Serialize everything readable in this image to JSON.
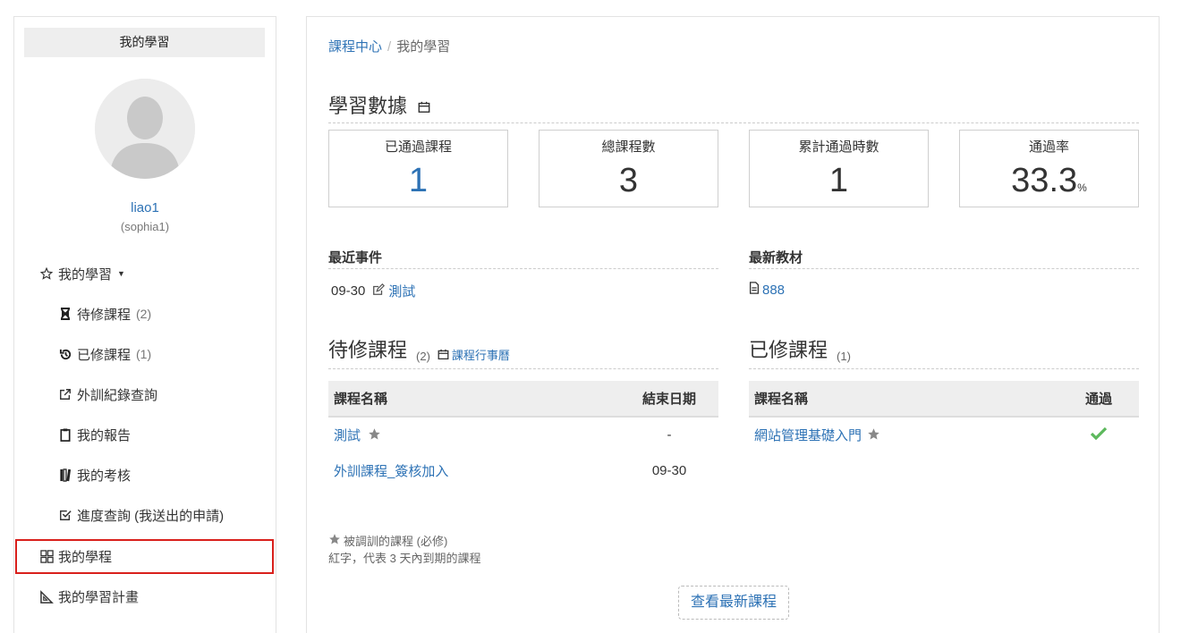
{
  "sidebar": {
    "header": "我的學習",
    "user_name": "liao1",
    "user_account": "(sophia1)",
    "items": [
      {
        "label": "我的學習",
        "icon": "star-outline-icon"
      },
      {
        "label": "待修課程",
        "count": "(2)",
        "icon": "hourglass-icon"
      },
      {
        "label": "已修課程",
        "count": "(1)",
        "icon": "history-icon"
      },
      {
        "label": "外訓紀錄查詢",
        "icon": "external-link-icon"
      },
      {
        "label": "我的報告",
        "icon": "clipboard-icon"
      },
      {
        "label": "我的考核",
        "icon": "books-icon"
      },
      {
        "label": "進度查詢 (我送出的申請)",
        "icon": "checkbox-icon"
      },
      {
        "label": "我的學程",
        "icon": "grid-icon"
      },
      {
        "label": "我的學習計畫",
        "icon": "triangle-ruler-icon"
      }
    ]
  },
  "breadcrumb": {
    "home": "課程中心",
    "current": "我的學習"
  },
  "stats": {
    "title": "學習數據",
    "boxes": [
      {
        "label": "已通過課程",
        "value": "1"
      },
      {
        "label": "總課程數",
        "value": "3"
      },
      {
        "label": "累計通過時數",
        "value": "1"
      },
      {
        "label": "通過率",
        "value": "33.3",
        "unit": "%"
      }
    ]
  },
  "recent_events": {
    "title": "最近事件",
    "date": "09-30",
    "event": "測試"
  },
  "latest_material": {
    "title": "最新教材",
    "item": "888"
  },
  "pending": {
    "title": "待修課程",
    "count": "(2)",
    "calendar_link": "課程行事曆",
    "headers": [
      "課程名稱",
      "結束日期"
    ],
    "rows": [
      {
        "name": "測試",
        "end": "-"
      },
      {
        "name": "外訓課程_簽核加入",
        "end": "09-30"
      }
    ]
  },
  "completed": {
    "title": "已修課程",
    "count": "(1)",
    "headers": [
      "課程名稱",
      "通過"
    ],
    "rows": [
      {
        "name": "網站管理基礎入門"
      }
    ]
  },
  "notes": {
    "line1": "被調訓的課程 (必修)",
    "line2": "紅字，代表 3 天內到期的課程"
  },
  "more_button": "查看最新課程",
  "colors": {
    "link": "#2d72b5",
    "active_border": "#d9201c",
    "check": "#5cb85c"
  }
}
